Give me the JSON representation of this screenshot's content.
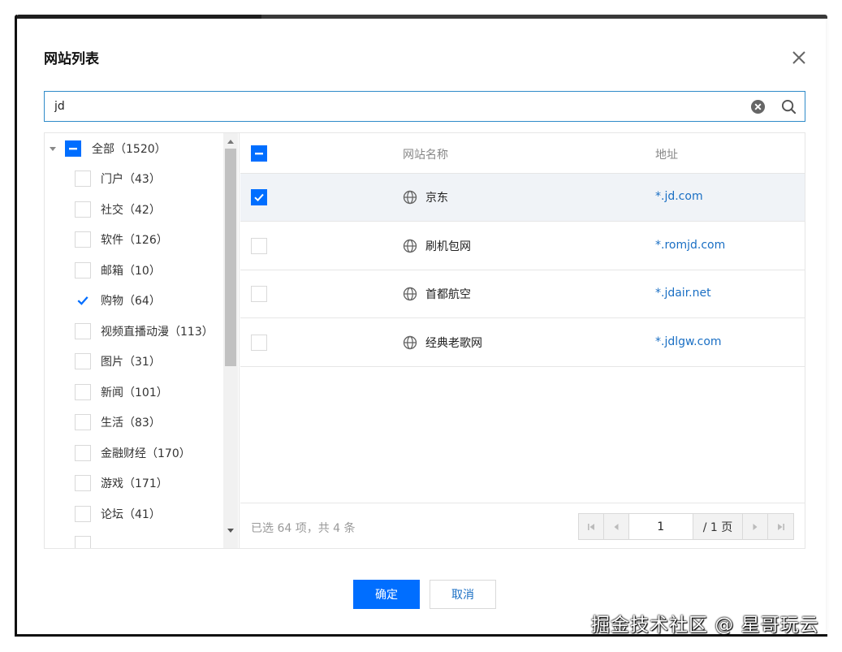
{
  "dialog": {
    "title": "网站列表",
    "close_icon": "close-icon"
  },
  "search": {
    "value": "jd",
    "placeholder": "",
    "clear_icon": "clear-circle-icon",
    "search_icon": "search-icon"
  },
  "tree": {
    "root": {
      "label": "全部（1520）",
      "state": "partial",
      "expanded": true
    },
    "items": [
      {
        "label": "门户（43）",
        "checked": false
      },
      {
        "label": "社交（42）",
        "checked": false
      },
      {
        "label": "软件（126）",
        "checked": false
      },
      {
        "label": "邮箱（10）",
        "checked": false
      },
      {
        "label": "购物（64）",
        "checked": true
      },
      {
        "label": "视频直播动漫（113）",
        "checked": false
      },
      {
        "label": "图片（31）",
        "checked": false
      },
      {
        "label": "新闻（101）",
        "checked": false
      },
      {
        "label": "生活（83）",
        "checked": false
      },
      {
        "label": "金融财经（170）",
        "checked": false
      },
      {
        "label": "游戏（171）",
        "checked": false
      },
      {
        "label": "论坛（41）",
        "checked": false
      }
    ]
  },
  "table": {
    "header_checkbox_state": "partial",
    "columns": {
      "name": "网站名称",
      "url": "地址"
    },
    "rows": [
      {
        "name": "京东",
        "url": "*.jd.com",
        "checked": true
      },
      {
        "name": "刷机包网",
        "url": "*.romjd.com",
        "checked": false
      },
      {
        "name": "首都航空",
        "url": "*.jdair.net",
        "checked": false
      },
      {
        "name": "经典老歌网",
        "url": "*.jdlgw.com",
        "checked": false
      }
    ],
    "row_icon": "globe-icon"
  },
  "footer": {
    "summary": "已选 64 项，共 4 条",
    "page_value": "1",
    "page_total": "/ 1 页"
  },
  "buttons": {
    "confirm": "确定",
    "cancel": "取消"
  },
  "watermark": "掘金技术社区 @ 星哥玩云",
  "colors": {
    "primary": "#006eff",
    "link": "#1a6fc4",
    "search_border": "#2f8bc9",
    "selected_row": "#f0f3f7"
  }
}
